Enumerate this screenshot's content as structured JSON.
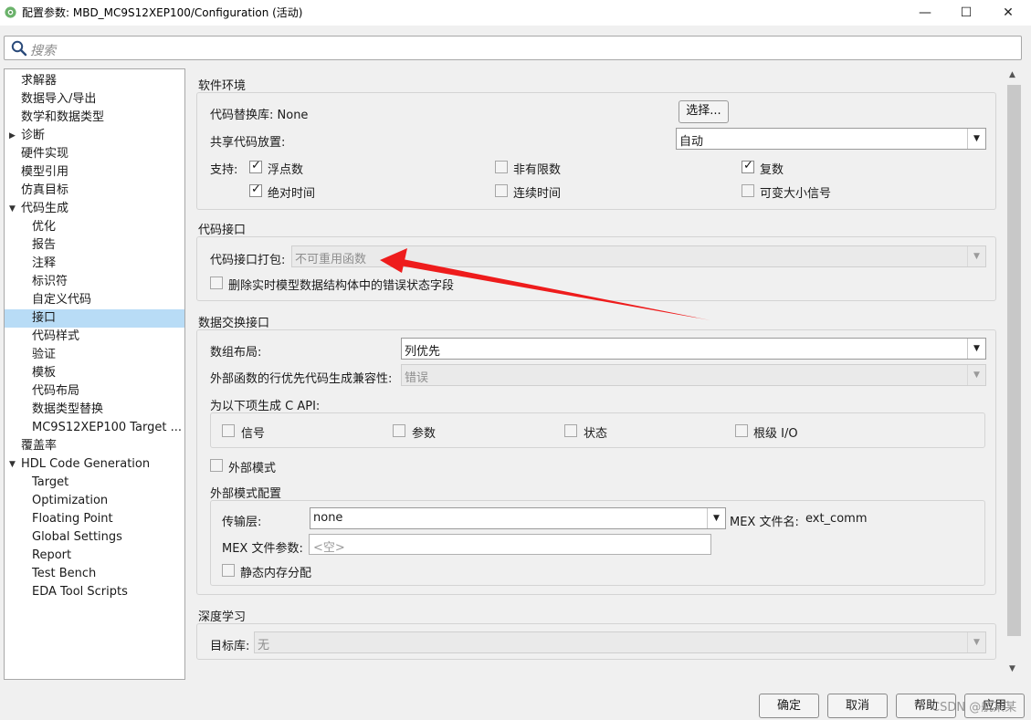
{
  "window": {
    "title": "配置参数: MBD_MC9S12XEP100/Configuration (活动)",
    "min_glyph": "—",
    "max_glyph": "☐",
    "close_glyph": "✕"
  },
  "search": {
    "placeholder": "搜索",
    "icon": "search-icon"
  },
  "tree": {
    "items": [
      {
        "label": "求解器"
      },
      {
        "label": "数据导入/导出"
      },
      {
        "label": "数学和数据类型"
      },
      {
        "label": "诊断",
        "expand": "▶"
      },
      {
        "label": "硬件实现"
      },
      {
        "label": "模型引用"
      },
      {
        "label": "仿真目标"
      },
      {
        "label": "代码生成",
        "expand": "▼"
      },
      {
        "label": "优化"
      },
      {
        "label": "报告"
      },
      {
        "label": "注释"
      },
      {
        "label": "标识符"
      },
      {
        "label": "自定义代码"
      },
      {
        "label": "接口",
        "selected": true
      },
      {
        "label": "代码样式"
      },
      {
        "label": "验证"
      },
      {
        "label": "模板"
      },
      {
        "label": "代码布局"
      },
      {
        "label": "数据类型替换"
      },
      {
        "label": "MC9S12XEP100 Target ..."
      },
      {
        "label": "覆盖率"
      },
      {
        "label": "HDL Code Generation",
        "expand": "▼"
      },
      {
        "label": "Target"
      },
      {
        "label": "Optimization"
      },
      {
        "label": "Floating Point"
      },
      {
        "label": "Global Settings"
      },
      {
        "label": "Report"
      },
      {
        "label": "Test Bench"
      },
      {
        "label": "EDA Tool Scripts"
      }
    ]
  },
  "software_env": {
    "title": "软件环境",
    "code_replacement_label": "代码替换库: None",
    "select_button": "选择...",
    "shared_code_label": "共享代码放置:",
    "shared_code_value": "自动",
    "support_label": "支持:",
    "floating_point": "浮点数",
    "non_finite": "非有限数",
    "complex": "复数",
    "absolute_time": "绝对时间",
    "continuous_time": "连续时间",
    "variable_size": "可变大小信号",
    "dropdown_glyph": "▼"
  },
  "code_interface": {
    "title": "代码接口",
    "packaging_label": "代码接口打包:",
    "packaging_value": "不可重用函数",
    "remove_error_status": "删除实时模型数据结构体中的错误状态字段"
  },
  "data_exchange": {
    "title": "数据交换接口",
    "array_layout_label": "数组布局:",
    "array_layout_value": "列优先",
    "external_compat_label": "外部函数的行优先代码生成兼容性:",
    "external_compat_value": "错误",
    "c_api_label": "为以下项生成 C API:",
    "capi_signals": "信号",
    "capi_params": "参数",
    "capi_states": "状态",
    "capi_root_io": "根级 I/O",
    "external_mode": "外部模式",
    "ext_config_title": "外部模式配置",
    "transport_label": "传输层:",
    "transport_value": "none",
    "mex_name_label": "MEX 文件名:",
    "mex_name_value": "ext_comm",
    "mex_args_label": "MEX 文件参数:",
    "mex_args_placeholder": "<空>",
    "static_memory": "静态内存分配"
  },
  "deep_learning": {
    "title": "深度学习",
    "target_lib_label": "目标库:",
    "target_lib_value": "无"
  },
  "footer": {
    "ok": "确定",
    "cancel": "取消",
    "help": "帮助",
    "apply": "应用",
    "watermark": "CSDN @航某某"
  },
  "annotation": {
    "arrow_color": "#ee1c1c"
  }
}
